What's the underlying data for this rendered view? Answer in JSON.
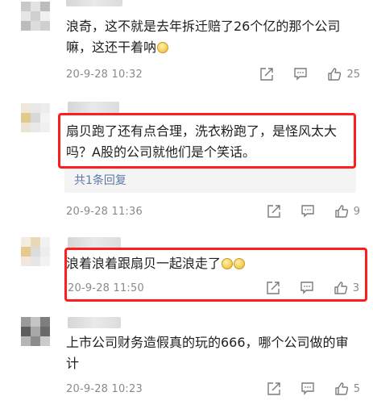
{
  "comments": [
    {
      "text": "浪奇，这不就是去年拆迁赔了26个亿的那个公司嘛，这还干着呐",
      "time": "20-9-28 10:32",
      "likes": "25"
    },
    {
      "text": "扇贝跑了还有点合理，洗衣粉跑了，是怪风太大吗？A股的公司就他们是个笑话。",
      "reply_link": "共1条回复",
      "time": "20-9-28 11:36",
      "likes": "9"
    },
    {
      "text": "浪着浪着跟扇贝一起浪走了",
      "time": "20-9-28 11:50",
      "likes": "3"
    },
    {
      "text": "上市公司财务造假真的玩的666，哪个公司做的审计",
      "time": "20-9-28 10:23",
      "likes": "5"
    }
  ],
  "icons": {
    "share": "share-icon",
    "reply": "comment-icon",
    "like": "thumbs-up-icon"
  },
  "colors": {
    "highlight": "#ff1d1d",
    "reply_link": "#5a78a8",
    "meta": "#8a8a8a"
  }
}
